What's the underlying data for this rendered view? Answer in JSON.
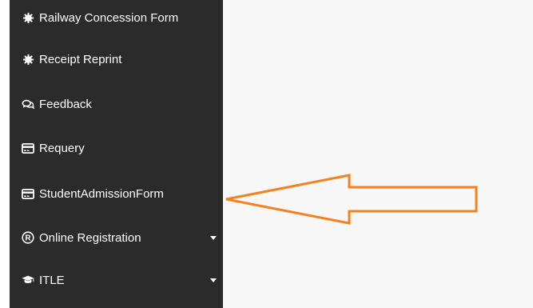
{
  "sidebar": {
    "items": [
      {
        "label": "Railway Concession Form",
        "icon": "gear-icon"
      },
      {
        "label": "Receipt Reprint",
        "icon": "gear-icon"
      },
      {
        "label": "Feedback",
        "icon": "chat-bubbles-icon"
      },
      {
        "label": "Requery",
        "icon": "credit-card-icon"
      },
      {
        "label": "StudentAdmissionForm",
        "icon": "credit-card-icon"
      },
      {
        "label": "Online Registration",
        "icon": "registered-icon",
        "has_dropdown": true
      },
      {
        "label": "ITLE",
        "icon": "graduation-cap-icon",
        "has_dropdown": true
      }
    ]
  },
  "annotation": {
    "type": "arrow",
    "points_to": "StudentAdmissionForm",
    "color": "#f58220"
  },
  "colors": {
    "sidebar_bg": "#2b2b2b",
    "content_bg": "#f7f7f7",
    "text": "#ffffff",
    "accent": "#f58220"
  }
}
